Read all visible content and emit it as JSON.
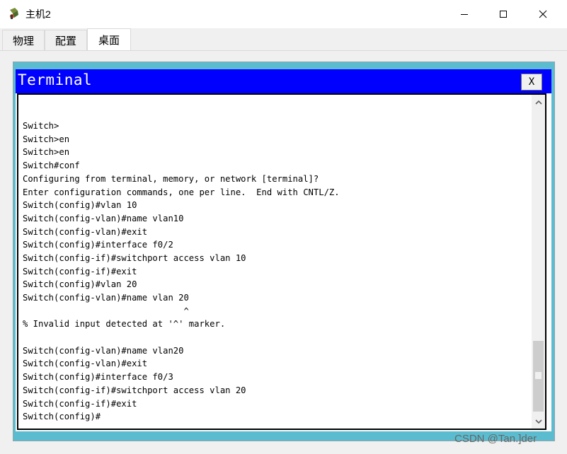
{
  "window": {
    "title": "主机2"
  },
  "tabs": [
    {
      "label": "物理"
    },
    {
      "label": "配置"
    },
    {
      "label": "桌面"
    }
  ],
  "terminal": {
    "title": "Terminal",
    "close_label": "X",
    "lines": [
      "",
      "",
      "",
      "Switch>",
      "Switch>en",
      "Switch>en",
      "Switch#conf",
      "Configuring from terminal, memory, or network [terminal]?",
      "Enter configuration commands, one per line.  End with CNTL/Z.",
      "Switch(config)#vlan 10",
      "Switch(config-vlan)#name vlan10",
      "Switch(config-vlan)#exit",
      "Switch(config)#interface f0/2",
      "Switch(config-if)#switchport access vlan 10",
      "Switch(config-if)#exit",
      "Switch(config)#vlan 20",
      "Switch(config-vlan)#name vlan 20",
      "                               ^",
      "% Invalid input detected at '^' marker.",
      "",
      "Switch(config-vlan)#name vlan20",
      "Switch(config-vlan)#exit",
      "Switch(config)#interface f0/3",
      "Switch(config-if)#switchport access vlan 20",
      "Switch(config-if)#exit",
      "Switch(config)#"
    ]
  },
  "icons": {
    "app": "packet-tracer-pc-icon",
    "minimize": "minimize-icon",
    "maximize": "maximize-icon",
    "close": "close-icon",
    "scroll_up": "chevron-up-icon",
    "scroll_down": "chevron-down-icon"
  },
  "colors": {
    "terminal_header": "#0000ff",
    "desktop_bg": "#5bbccf"
  },
  "watermark": "CSDN @Tan.]der"
}
